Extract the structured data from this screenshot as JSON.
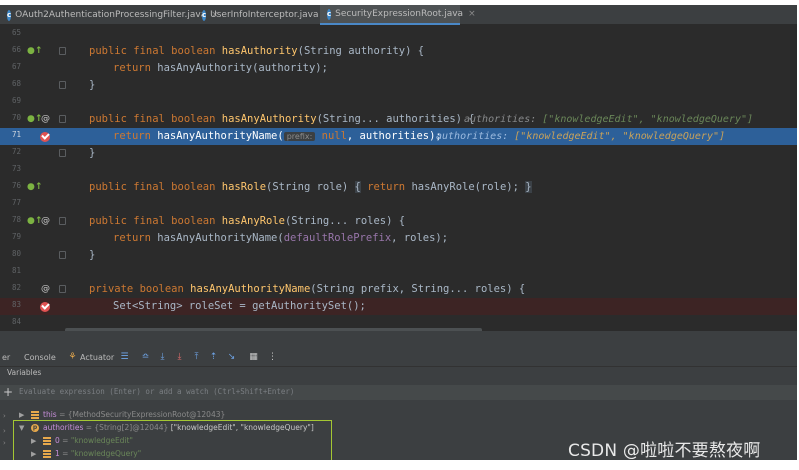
{
  "tabs": [
    {
      "label": "OAuth2AuthenticationProcessingFilter.java",
      "active": false
    },
    {
      "label": "UserInfoInterceptor.java",
      "active": false
    },
    {
      "label": "SecurityExpressionRoot.java",
      "active": true
    }
  ],
  "tab_close_glyph": "×",
  "file_icon_glyph": "c",
  "code_lines": [
    {
      "num": "65"
    },
    {
      "num": "66",
      "t1": "public final boolean ",
      "fn": "hasAuthority",
      "t2": "(String authority) {"
    },
    {
      "num": "67",
      "t1": "return ",
      "t2": "hasAnyAuthority(authority);"
    },
    {
      "num": "68",
      "t2": "}"
    },
    {
      "num": "69"
    },
    {
      "num": "70",
      "t1": "public final boolean ",
      "fn": "hasAnyAuthority",
      "t2": "(String... authorities) {",
      "iv_name": "authorities: ",
      "iv_val": "[\"knowledgeEdit\", \"knowledgeQuery\"]"
    },
    {
      "num": "71",
      "t1": "return ",
      "t2": "hasAnyAuthorityName(",
      "hint": "prefix:",
      "t3": " null",
      "t4": ", authorities);",
      "iv_name": "authorities: ",
      "iv_val": "[\"knowledgeEdit\", \"knowledgeQuery\"]"
    },
    {
      "num": "72",
      "t2": "}"
    },
    {
      "num": "73"
    },
    {
      "num": "76",
      "t1": "public final boolean ",
      "fn": "hasRole",
      "t2": "(String role) ",
      "b1": "{",
      "t3": " return ",
      "t4": "hasAnyRole(role); ",
      "b2": "}"
    },
    {
      "num": "77"
    },
    {
      "num": "78",
      "t1": "public final boolean ",
      "fn": "hasAnyRole",
      "t2": "(String... roles) {"
    },
    {
      "num": "79",
      "t1": "return ",
      "t2": "hasAnyAuthorityName(",
      "pl": "defaultRolePrefix",
      "t3": ", roles);"
    },
    {
      "num": "80",
      "t2": "}"
    },
    {
      "num": "81"
    },
    {
      "num": "82",
      "t1": "private boolean ",
      "fn": "hasAnyAuthorityName",
      "t2": "(String prefix, String... roles) {"
    },
    {
      "num": "83",
      "t2": "Set<String> roleSet = getAuthoritySet();"
    },
    {
      "num": "84"
    }
  ],
  "gutter": {
    "impl_glyph": "●↑",
    "at_glyph": "@"
  },
  "debug": {
    "tabs": [
      "er",
      "Console",
      "Actuator"
    ],
    "variables_label": "Variables",
    "eval_placeholder": "Evaluate expression (Enter) or add a watch (Ctrl+Shift+Enter)",
    "vars": [
      {
        "name": "this",
        "meta": " = {MethodSecurityExpressionRoot@12043}",
        "value": ""
      },
      {
        "name": "authorities",
        "meta": " = {String[2]@12044} ",
        "value": "[\"knowledgeEdit\", \"knowledgeQuery\"]"
      },
      {
        "name": "0",
        "meta": " = ",
        "value": "\"knowledgeEdit\""
      },
      {
        "name": "1",
        "meta": " = ",
        "value": "\"knowledgeQuery\""
      }
    ]
  },
  "watermark": "CSDN @啦啦不要熬夜啊",
  "colors": {
    "accent": "#2d6099",
    "keyword": "#cc7832",
    "function": "#ffc66d",
    "string": "#6a8759",
    "breakpoint": "#e05252",
    "selection_border": "#a4c733"
  }
}
